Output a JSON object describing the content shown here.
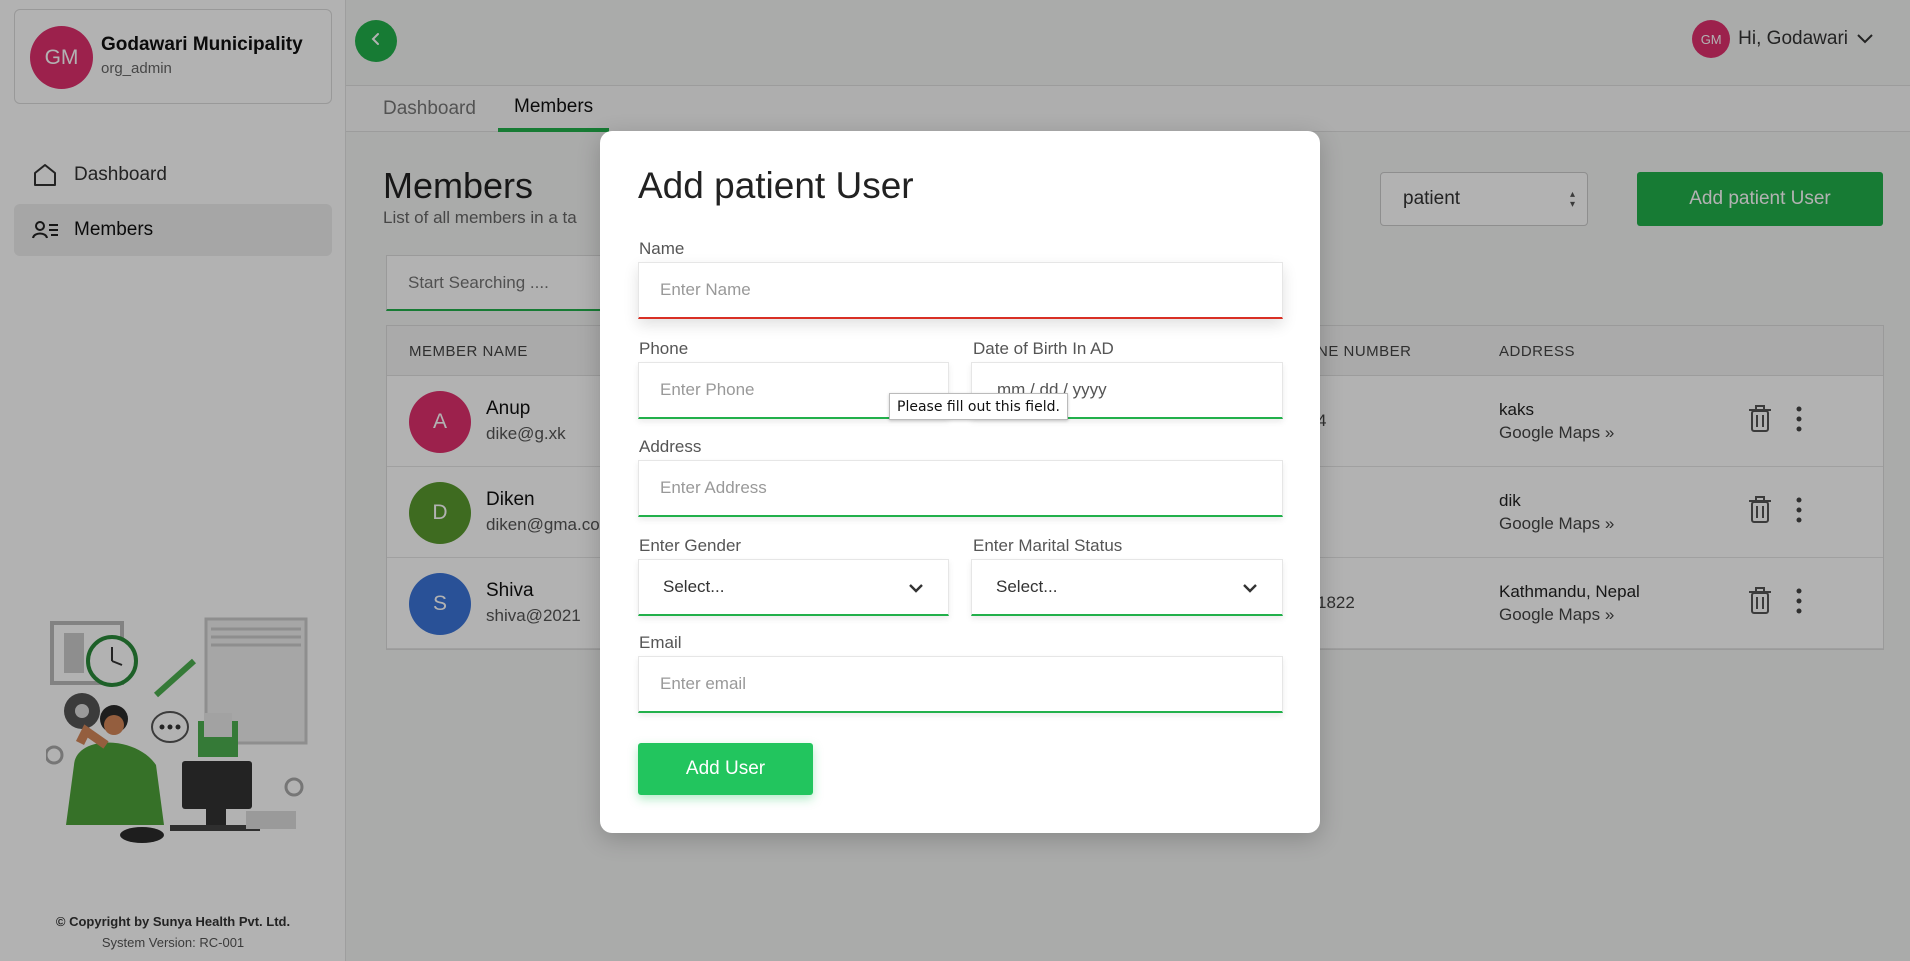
{
  "org": {
    "initials": "GM",
    "name": "Godawari Municipality",
    "role": "org_admin"
  },
  "sidebar": {
    "items": [
      {
        "label": "Dashboard",
        "icon": "home-icon"
      },
      {
        "label": "Members",
        "icon": "members-icon"
      }
    ],
    "copyright": "© Copyright by Sunya Health Pvt. Ltd.",
    "version": "System Version: RC-001"
  },
  "header": {
    "user_initials": "GM",
    "greeting": "Hi, Godawari"
  },
  "tabs": [
    "Dashboard",
    "Members"
  ],
  "page": {
    "title": "Members",
    "subtitle": "List of all members in a ta",
    "search_placeholder": "Start Searching ....",
    "role_value": "patient",
    "add_button": "Add patient User"
  },
  "table": {
    "headers": {
      "member_name": "MEMBER NAME",
      "phone": "NE NUMBER",
      "address": "ADDRESS"
    },
    "rows": [
      {
        "initial": "A",
        "name": "Anup",
        "email": "dike@g.xk",
        "phone": "4",
        "address": "kaks",
        "maps": "Google Maps",
        "color": "#e0306e"
      },
      {
        "initial": "D",
        "name": "Diken",
        "email": "diken@gma.co",
        "phone": "",
        "address": "dik",
        "maps": "Google Maps",
        "color": "#5a9a2e"
      },
      {
        "initial": "S",
        "name": "Shiva",
        "email": "shiva@2021",
        "phone": "1822",
        "address": "Kathmandu, Nepal",
        "maps": "Google Maps",
        "color": "#3b74d8"
      }
    ]
  },
  "modal": {
    "title": "Add patient User",
    "name_label": "Name",
    "name_placeholder": "Enter Name",
    "phone_label": "Phone",
    "phone_placeholder": "Enter Phone",
    "dob_label": "Date of Birth In AD",
    "dob_placeholder": "mm / dd / yyyy",
    "address_label": "Address",
    "address_placeholder": "Enter Address",
    "gender_label": "Enter Gender",
    "gender_value": "Select...",
    "marital_label": "Enter Marital Status",
    "marital_value": "Select...",
    "email_label": "Email",
    "email_placeholder": "Enter email",
    "submit_label": "Add User",
    "tooltip": "Please fill out this field."
  },
  "colors": {
    "accent": "#22b04b",
    "avatar_pink": "#e0306e",
    "error": "#d93025"
  }
}
